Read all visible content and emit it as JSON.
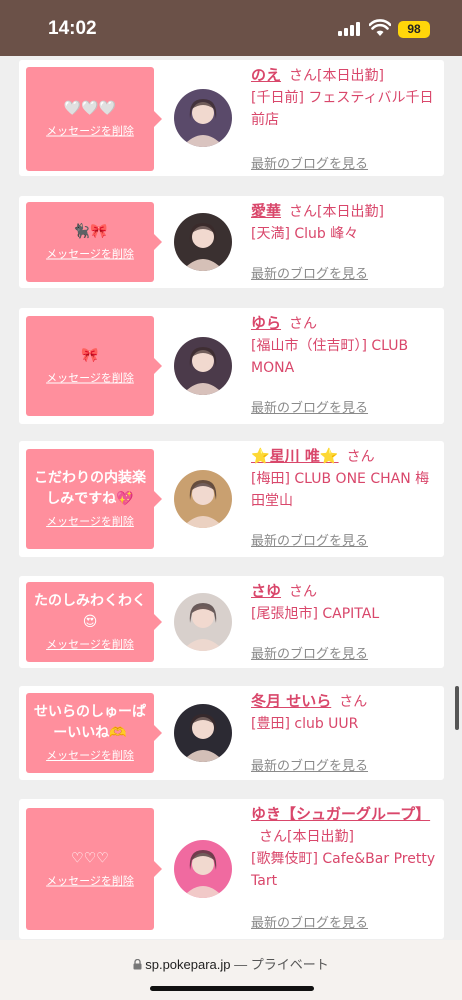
{
  "status": {
    "time": "14:02",
    "battery": "98"
  },
  "cards": [
    {
      "msg": "🤍🤍🤍",
      "delete": "メッセージを削除",
      "name": "のえ",
      "san": "さん",
      "tag": "[本日出勤]",
      "shop": "[千日前] フェスティバル千日前店",
      "blog": "最新のブログを見る",
      "avatar_color": "#5a4a6a"
    },
    {
      "msg": "🐈‍⬛🎀",
      "delete": "メッセージを削除",
      "name": "愛華",
      "san": "さん",
      "tag": "[本日出勤]",
      "shop": "[天満] Club 峰々",
      "blog": "最新のブログを見る",
      "avatar_color": "#3a3030"
    },
    {
      "msg": "🎀",
      "delete": "メッセージを削除",
      "name": "ゆら",
      "san": "さん",
      "tag": "",
      "shop": "[福山市（住吉町）] CLUB MONA",
      "blog": "最新のブログを見る",
      "avatar_color": "#4b3a4a"
    },
    {
      "msg": "こだわりの内装楽しみですね💖",
      "delete": "メッセージを削除",
      "name": "⭐星川 唯⭐",
      "san": "さん",
      "tag": "",
      "shop": "[梅田] CLUB ONE CHAN 梅田堂山",
      "blog": "最新のブログを見る",
      "avatar_color": "#c9a070"
    },
    {
      "msg": "たのしみわくわく😍",
      "delete": "メッセージを削除",
      "name": "さゆ",
      "san": "さん",
      "tag": "",
      "shop": "[尾張旭市] CAPITAL",
      "blog": "最新のブログを見る",
      "avatar_color": "#d8d0cc"
    },
    {
      "msg": "せいらのしゅーぱーいいね🫶",
      "delete": "メッセージを削除",
      "name": "冬月 せいら",
      "san": "さん",
      "tag": "",
      "shop": "[豊田] club UUR",
      "blog": "最新のブログを見る",
      "avatar_color": "#2c2a33"
    },
    {
      "msg": "♡♡♡",
      "delete": "メッセージを削除",
      "name": "ゆき【シュガーグループ】",
      "san": "さん",
      "tag": "[本日出勤]",
      "shop": "[歌舞伎町] Cafe&Bar Pretty Tart",
      "blog": "最新のブログを見る",
      "avatar_color": "#f06aa0"
    }
  ],
  "urlbar": {
    "domain": "sp.pokepara.jp",
    "suffix": " — プライベート"
  }
}
